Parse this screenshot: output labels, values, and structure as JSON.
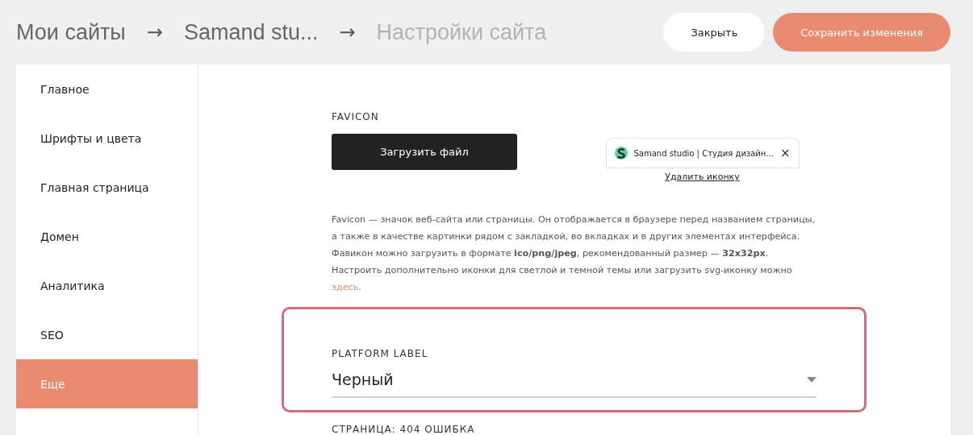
{
  "breadcrumbs": [
    {
      "label": "Мои сайты",
      "current": false
    },
    {
      "label": "Samand stu...",
      "current": false
    },
    {
      "label": "Настройки сайта",
      "current": true
    }
  ],
  "breadcrumb_separator": "→",
  "buttons": [
    {
      "label": "Закрыть",
      "kind": "secondary"
    },
    {
      "label": "Сохранить изменения",
      "kind": "primary"
    }
  ],
  "sidebar": {
    "items": [
      {
        "label": "Главное",
        "selected": false
      },
      {
        "label": "Шрифты и цвета",
        "selected": false
      },
      {
        "label": "Главная страница",
        "selected": false
      },
      {
        "label": "Домен",
        "selected": false
      },
      {
        "label": "Аналитика",
        "selected": false
      },
      {
        "label": "SEO",
        "selected": false
      },
      {
        "label": "Еще",
        "selected": true
      }
    ]
  },
  "favicon": {
    "title": "FAVICON",
    "upload_button": "Загрузить файл",
    "tab_preview": {
      "title": "Samand studio | Студия дизайн...",
      "close": "×"
    },
    "delete_link": "Удалить иконку",
    "description": "Favicon — значок веб-сайта или страницы. Он отображается в браузере перед названием страницы, а также в качестве картинки рядом с закладкой, во вкладках и в других элементах интерфейса. Фавикон можно загрузить в формате **ico/png/jpeg**, рекомендованный размер — **32x32px**. Настроить дополнительно иконки для светлой и темной темы или загрузить svg-иконку можно ",
    "description_link": "здесь",
    "description_end": "."
  },
  "platform_label": {
    "label": "PLATFORM LABEL",
    "value": "Черный",
    "highlighted": true
  },
  "next_section": {
    "title": "СТРАНИЦА: 404 ОШИБКА"
  }
}
